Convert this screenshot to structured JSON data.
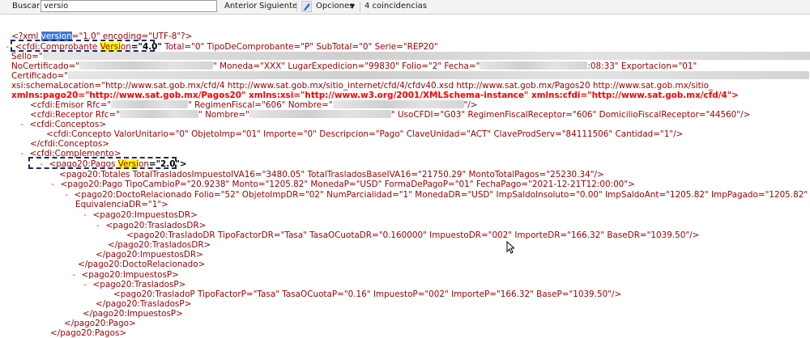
{
  "findbar": {
    "label": "Buscar:",
    "search_value": "versio",
    "prev": "Anterior",
    "next": "Siguiente",
    "options": "Opciones",
    "matches": "4 coincidencias"
  },
  "xml": {
    "decl_open": "<?xml ",
    "decl_version_attr": "version",
    "decl_rest": "=\"1.0\" encoding=\"UTF-8\"?>",
    "comp_minus": "- ",
    "comp_tag": "<cfdi:Comprobante ",
    "comp_ver_a": "Versi",
    "comp_ver_b": "on",
    "comp_ver_val": "=\"4.0\"",
    "comp_rest": " Total=\"0\" TipoDeComprobante=\"P\" SubTotal=\"0\" Serie=\"REP20\"",
    "sello": "Sello=\"",
    "nocert_label": "NoCertificado=\"",
    "nocert_rest": "\" Moneda=\"XXX\" LugarExpedicion=\"99830\" Folio=\"2\" Fecha=\"",
    "fecha_tail": ":08:33\" Exportacion=\"01\"",
    "certificado": "Certificado=\"",
    "schemaloc": "xsi:schemaLocation=\"http://www.sat.gob.mx/cfd/4 http://www.sat.gob.mx/sitio_internet/cfd/4/cfdv40.xsd http://www.sat.gob.mx/Pagos20 http://www.sat.gob.mx/sitio_",
    "xmlns_line": "xmlns:pago20=\"http://www.sat.gob.mx/Pagos20\" xmlns:xsi=\"http://www.w3.org/2001/XMLSchema-instance\" xmlns:cfdi=\"http://www.sat.gob.mx/cfd/4\">",
    "emisor_a": "<cfdi:Emisor Rfc=\"",
    "emisor_b": "\" RegimenFiscal=\"606\" Nombre=\"",
    "emisor_c": "\"/>",
    "receptor_a": "<cfdi:Receptor Rfc=\"",
    "receptor_b": "\" Nombre=\"",
    "receptor_c": "\" UsoCFDI=\"G03\" RegimenFiscalReceptor=\"606\" DomicilioFiscalReceptor=\"44560\"/>",
    "minus": "- ",
    "conceptos_open": "<cfdi:Conceptos>",
    "concepto": "<cfdi:Concepto ValorUnitario=\"0\" ObjetoImp=\"01\" Importe=\"0\" Descripcion=\"Pago\" ClaveUnidad=\"ACT\" ClaveProdServ=\"84111506\" Cantidad=\"1\"/>",
    "conceptos_close": "</cfdi:Conceptos>",
    "complemento_open": "<cfdi:Complemento>",
    "pagos_tag": "<pago20:Pagos ",
    "pagos_ver_a": "Versi",
    "pagos_ver_b": "on",
    "pagos_ver_val": "=\"2.0\">",
    "totales": "<pago20:Totales TotalTrasladosImpuestoIVA16=\"3480.05\" TotalTrasladosBaseIVA16=\"21750.29\" MontoTotalPagos=\"25230.34\"/>",
    "pago": "<pago20:Pago TipoCambioP=\"20.9238\" Monto=\"1205.82\" MonedaP=\"USD\" FormaDePagoP=\"01\" FechaPago=\"2021-12-21T12:00:00\">",
    "docto": "<pago20:DoctoRelacionado Folio=\"52\" ObjetoImpDR=\"02\" NumParcialidad=\"1\" MonedaDR=\"USD\" ImpSaldoInsoluto=\"0.00\" ImpSaldoAnt=\"1205.82\" ImpPagado=\"1205.82\" I",
    "docto_cont": "EquivalenciaDR=\"1\">",
    "impuestosdr_open": "<pago20:ImpuestosDR>",
    "trasladosdr_open": "<pago20:TrasladosDR>",
    "trasladodr": "<pago20:TrasladoDR TipoFactorDR=\"Tasa\" TasaOCuotaDR=\"0.160000\" ImpuestoDR=\"002\" ImporteDR=\"166.32\" BaseDR=\"1039.50\"/>",
    "trasladosdr_close": "</pago20:TrasladosDR>",
    "impuestosdr_close": "</pago20:ImpuestosDR>",
    "docto_close": "</pago20:DoctoRelacionado>",
    "impuestosp_open": "<pago20:ImpuestosP>",
    "trasladosp_open": "<pago20:TrasladosP>",
    "trasladop": "<pago20:TrasladoP TipoFactorP=\"Tasa\" TasaOCuotaP=\"0.16\" ImpuestoP=\"002\" ImporteP=\"166.32\" BaseP=\"1039.50\"/>",
    "trasladosp_close": "</pago20:TrasladosP>",
    "impuestosp_close": "</pago20:ImpuestosP>",
    "pago_close": "</pago20:Pago>",
    "pagos_close": "</pago20:Pagos>"
  }
}
